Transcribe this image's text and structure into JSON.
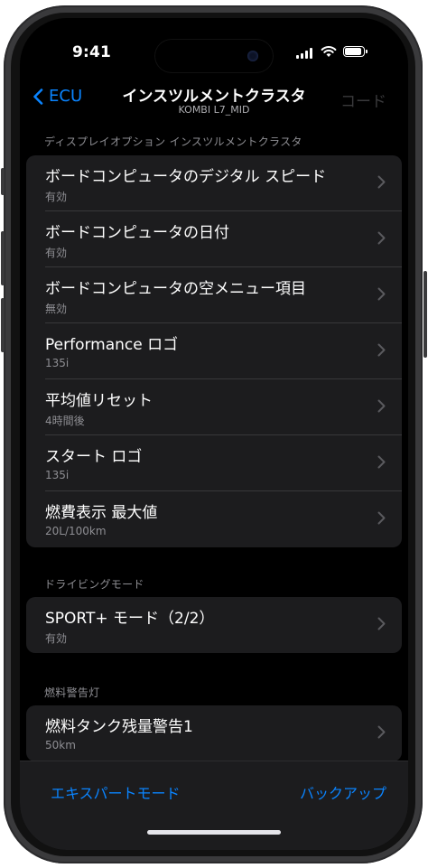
{
  "status_bar": {
    "time": "9:41",
    "battery_level": 0.9
  },
  "nav": {
    "back_label": "ECU",
    "title": "インスツルメントクラスタ",
    "subtitle": "KOMBI L7_MID",
    "code_label": "コード"
  },
  "sections": [
    {
      "header": "ディスプレイオプション インスツルメントクラスタ",
      "rows": [
        {
          "title": "ボードコンピュータのデジタル スピード",
          "value": "有効"
        },
        {
          "title": "ボードコンピュータの日付",
          "value": "有効"
        },
        {
          "title": "ボードコンピュータの空メニュー項目",
          "value": "無効"
        },
        {
          "title": "Performance ロゴ",
          "value": "135i"
        },
        {
          "title": "平均値リセット",
          "value": "4時間後"
        },
        {
          "title": "スタート ロゴ",
          "value": "135i"
        },
        {
          "title": "燃費表示 最大値",
          "value": "20L/100km"
        }
      ]
    },
    {
      "header": "ドライビングモード",
      "rows": [
        {
          "title": "SPORT+ モード（2/2）",
          "value": "有効"
        }
      ]
    },
    {
      "header": "燃料警告灯",
      "rows": [
        {
          "title": "燃料タンク残量警告1",
          "value": "50km"
        }
      ]
    }
  ],
  "toolbar": {
    "expert_mode_label": "エキスパートモード",
    "backup_label": "バックアップ"
  },
  "colors": {
    "accent": "#0a84ff",
    "background": "#000000",
    "cell": "#1c1c1e",
    "secondary_text": "#8e8e93"
  }
}
